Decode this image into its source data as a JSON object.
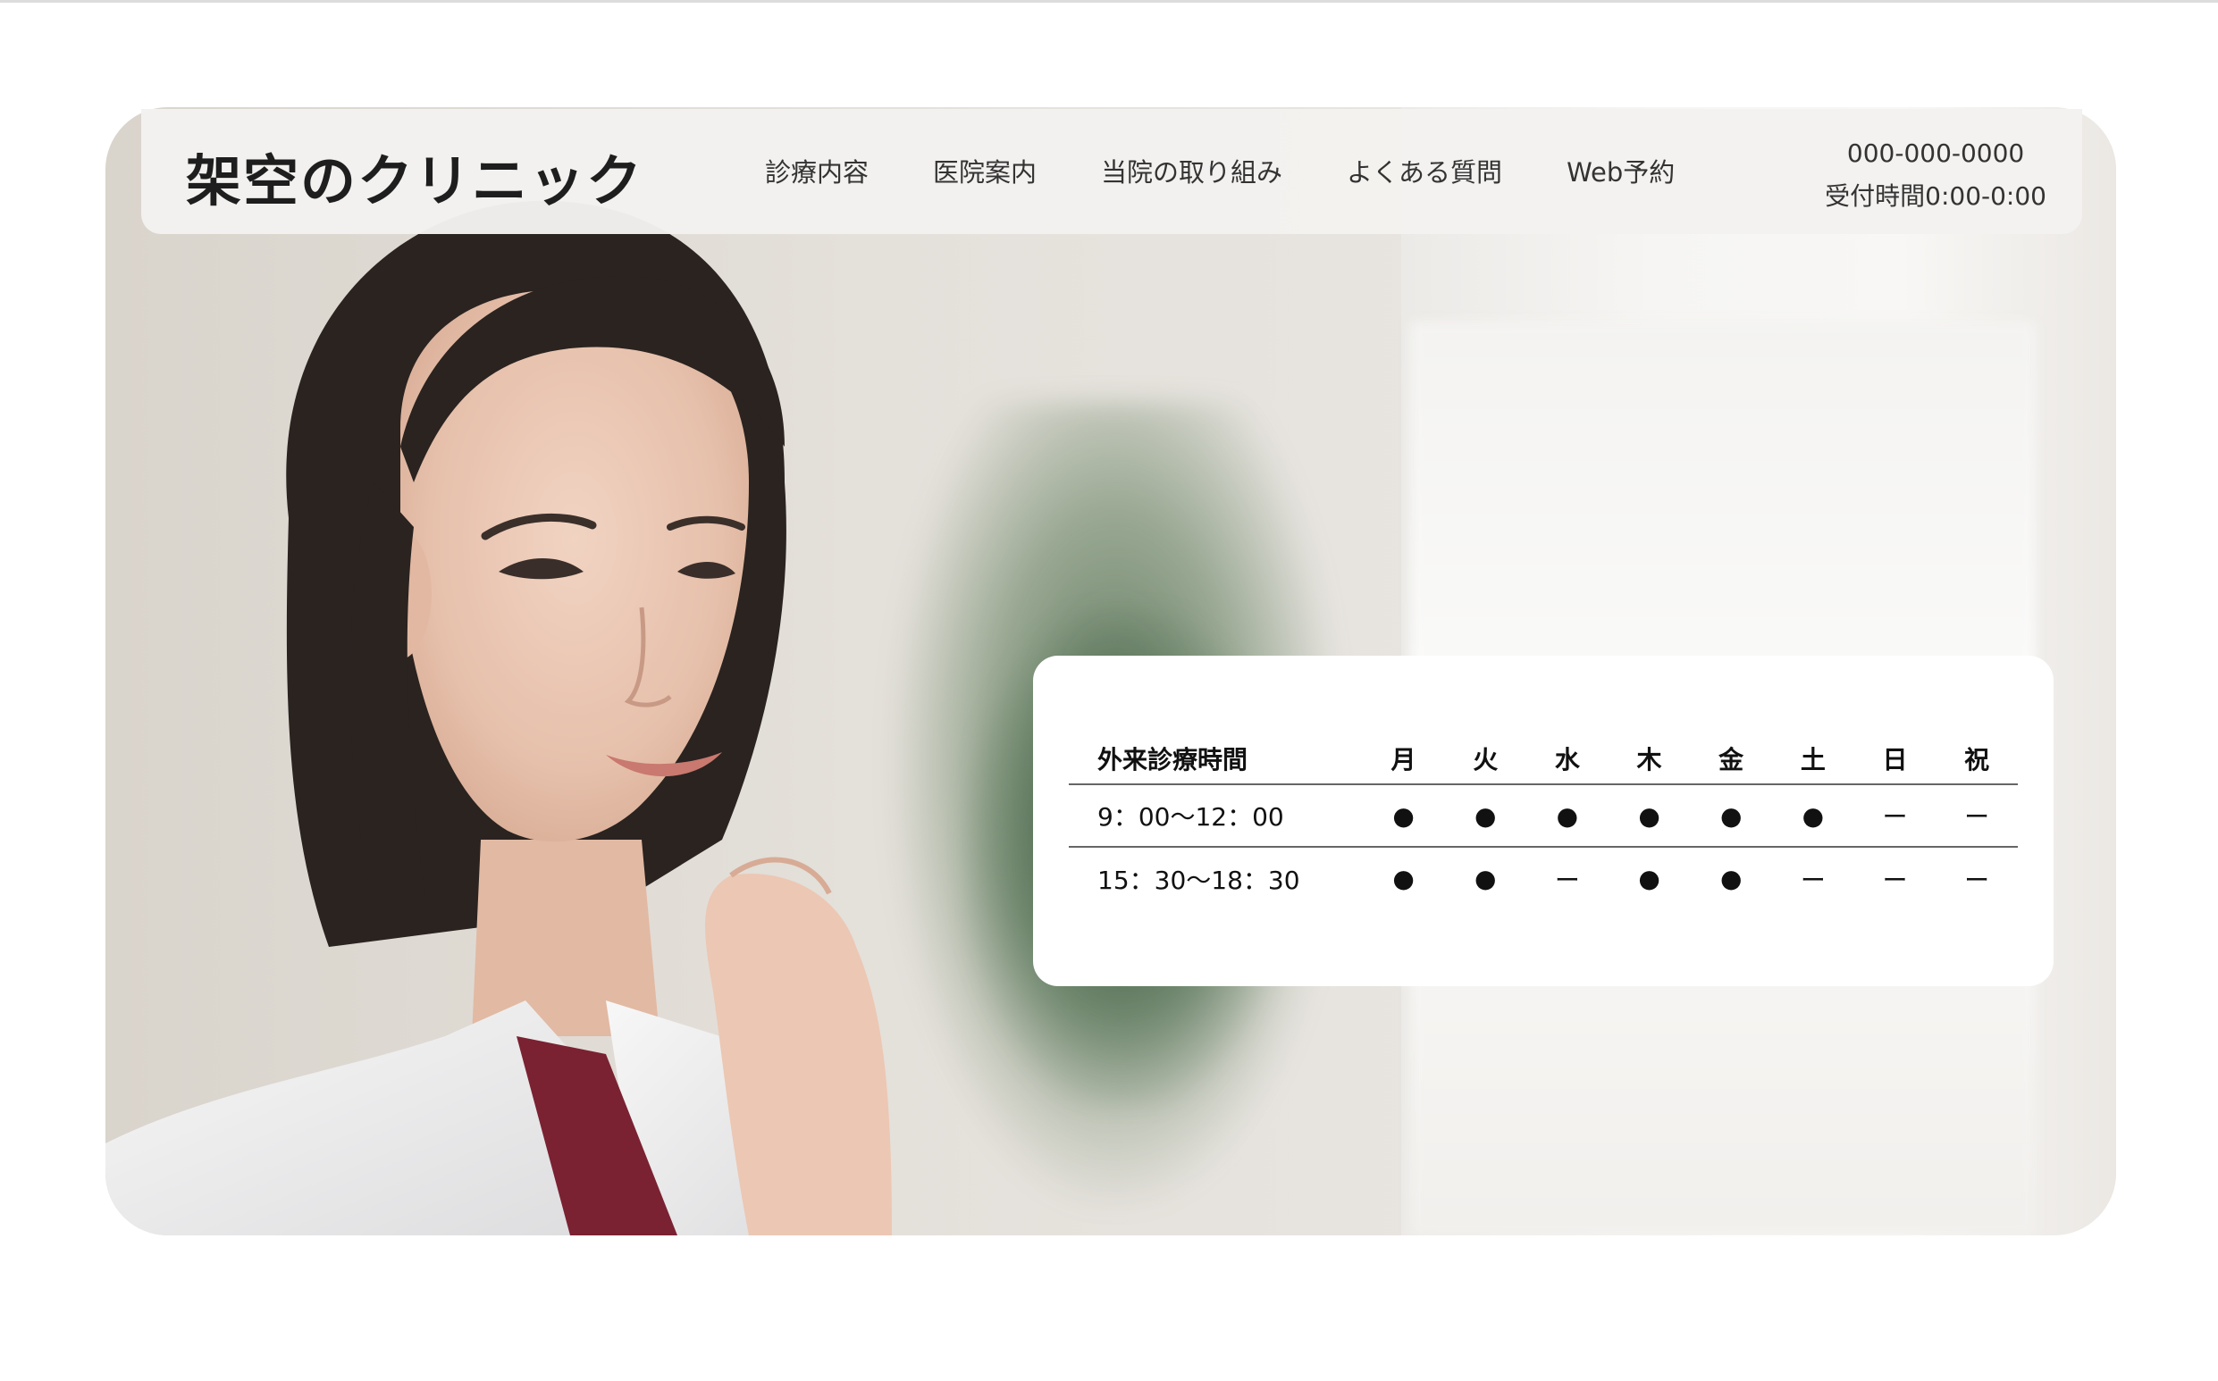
{
  "header": {
    "logo": "架空のクリニック",
    "nav": [
      "診療内容",
      "医院案内",
      "当院の取り組み",
      "よくある質問",
      "Web予約"
    ],
    "phone": "000-000-0000",
    "hours": "受付時間0:00-0:00"
  },
  "schedule": {
    "title": "外来診療時間",
    "days": [
      "月",
      "火",
      "水",
      "木",
      "金",
      "土",
      "日",
      "祝"
    ],
    "rows": [
      {
        "time": "9：00〜12：00",
        "marks": [
          "●",
          "●",
          "●",
          "●",
          "●",
          "●",
          "ー",
          "ー"
        ]
      },
      {
        "time": "15：30〜18：30",
        "marks": [
          "●",
          "●",
          "ー",
          "●",
          "●",
          "ー",
          "ー",
          "ー"
        ]
      }
    ]
  },
  "colors": {
    "header_bg": "#f3f2ef",
    "card_bg": "#ffffff",
    "text": "#222222"
  }
}
